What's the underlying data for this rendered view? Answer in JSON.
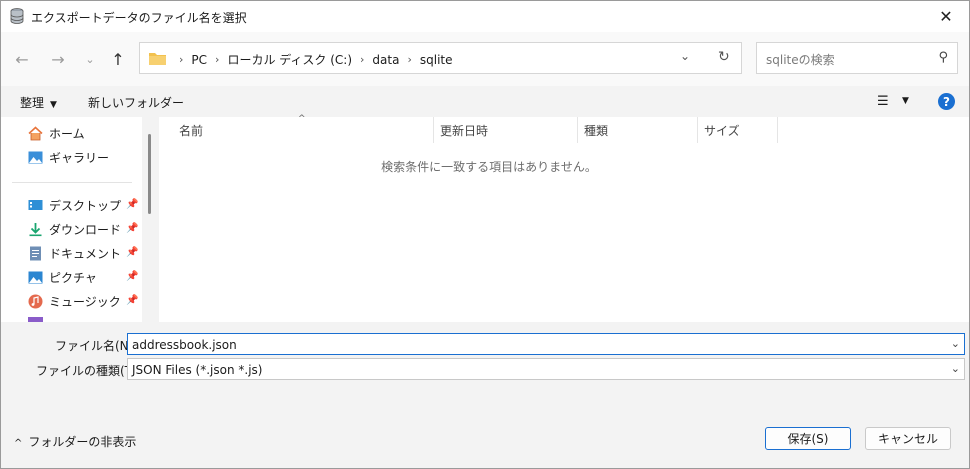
{
  "window": {
    "title": "エクスポートデータのファイル名を選択"
  },
  "nav": {
    "breadcrumbs": [
      "PC",
      "ローカル ディスク (C:)",
      "data",
      "sqlite"
    ],
    "search_placeholder": "sqliteの検索"
  },
  "toolbar": {
    "organize_label": "整理",
    "new_folder_label": "新しいフォルダー"
  },
  "sidebar": {
    "items": [
      {
        "label": "ホーム",
        "icon": "home-icon",
        "pinned": false
      },
      {
        "label": "ギャラリー",
        "icon": "gallery-icon",
        "pinned": false
      },
      {
        "label": "デスクトップ",
        "icon": "desktop-icon",
        "pinned": true
      },
      {
        "label": "ダウンロード",
        "icon": "download-icon",
        "pinned": true
      },
      {
        "label": "ドキュメント",
        "icon": "document-icon",
        "pinned": true
      },
      {
        "label": "ピクチャ",
        "icon": "pictures-icon",
        "pinned": true
      },
      {
        "label": "ミュージック",
        "icon": "music-icon",
        "pinned": true
      }
    ]
  },
  "file_list": {
    "columns": [
      "名前",
      "更新日時",
      "種類",
      "サイズ"
    ],
    "empty_message": "検索条件に一致する項目はありません。"
  },
  "form": {
    "filename_label": "ファイル名(N):",
    "filename_value": "addressbook.json",
    "filetype_label": "ファイルの種類(T):",
    "filetype_value": "JSON Files (*.json *.js)"
  },
  "footer": {
    "hide_folders_label": "フォルダーの非表示",
    "save_label": "保存(S)",
    "cancel_label": "キャンセル"
  },
  "colors": {
    "accent": "#1a6fd1",
    "folder": "#f2c14e"
  }
}
